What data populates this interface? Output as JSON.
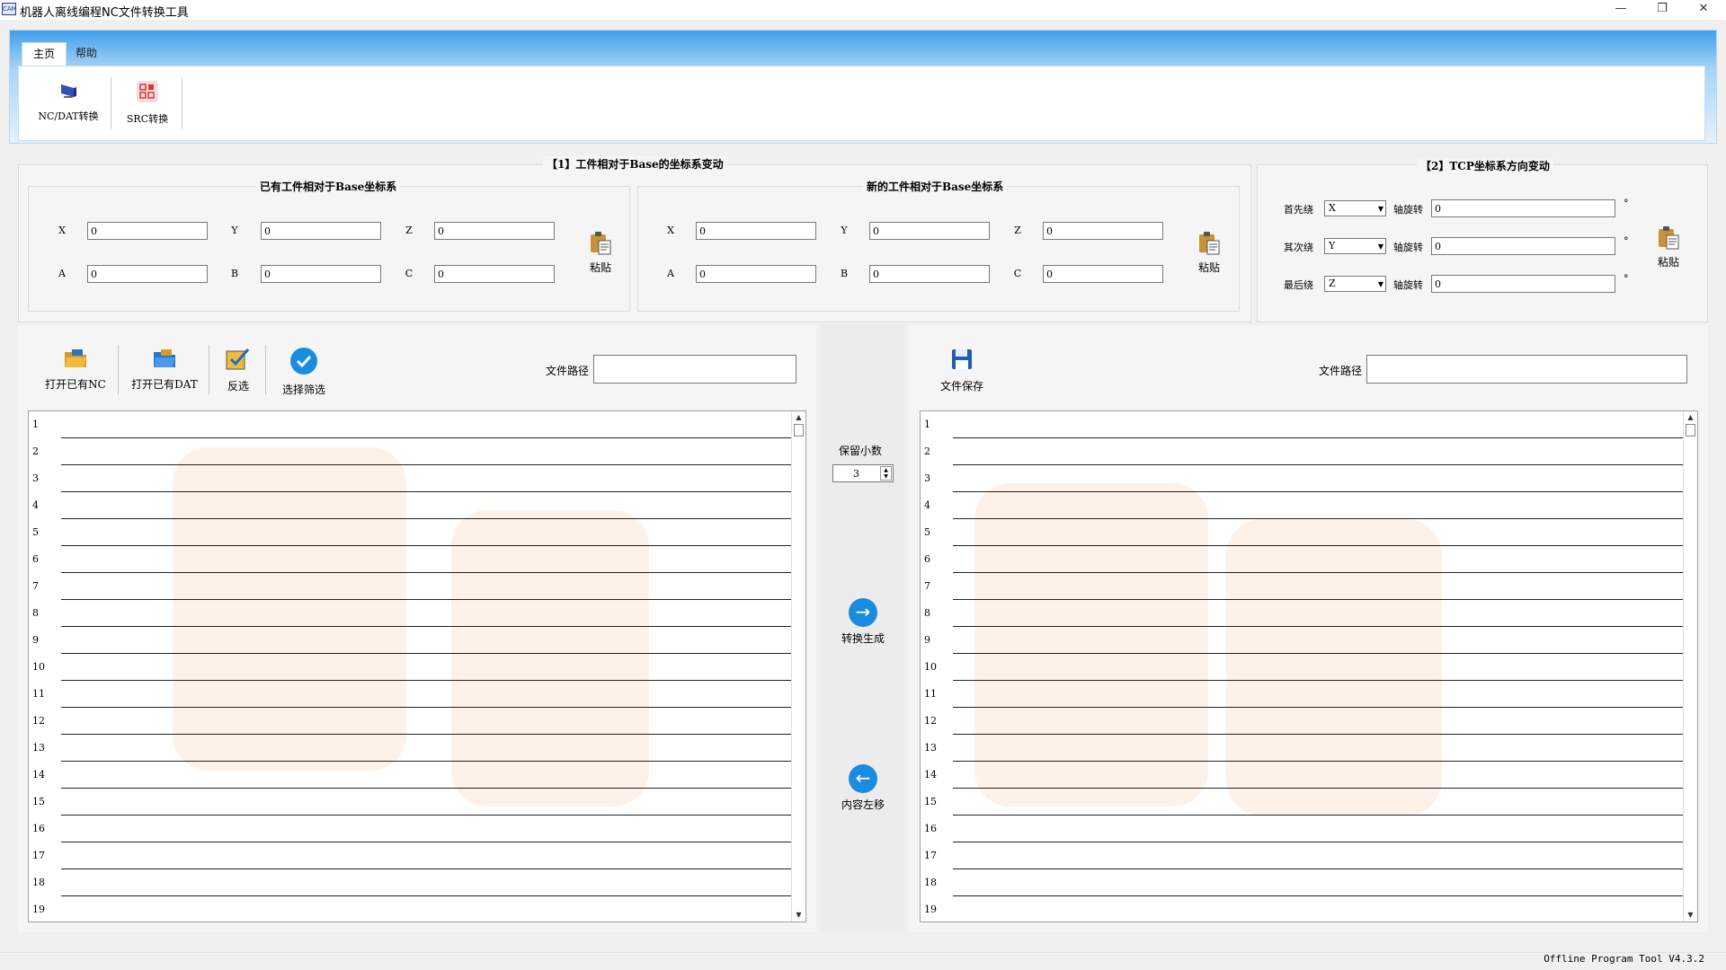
{
  "window": {
    "icon_text": "CAM",
    "title": "机器人离线编程NC文件转换工具",
    "minimize": "—",
    "restore": "❐",
    "close": "✕"
  },
  "ribbon": {
    "tabs": [
      "主页",
      "帮助"
    ],
    "buttons": [
      {
        "label": "NC/DAT转换",
        "icon": "monitor-icon"
      },
      {
        "label": "SRC转换",
        "icon": "src-grid-icon"
      }
    ]
  },
  "workpiece": {
    "title": "【1】工件相对于Base的坐标系变动",
    "existing": {
      "title": "已有工件相对于Base坐标系",
      "fields": [
        {
          "label": "X",
          "value": "0"
        },
        {
          "label": "Y",
          "value": "0"
        },
        {
          "label": "Z",
          "value": "0"
        },
        {
          "label": "A",
          "value": "0"
        },
        {
          "label": "B",
          "value": "0"
        },
        {
          "label": "C",
          "value": "0"
        }
      ],
      "paste_label": "粘贴"
    },
    "new": {
      "title": "新的工件相对于Base坐标系",
      "fields": [
        {
          "label": "X",
          "value": "0"
        },
        {
          "label": "Y",
          "value": "0"
        },
        {
          "label": "Z",
          "value": "0"
        },
        {
          "label": "A",
          "value": "0"
        },
        {
          "label": "B",
          "value": "0"
        },
        {
          "label": "C",
          "value": "0"
        }
      ],
      "paste_label": "粘贴"
    }
  },
  "tcp": {
    "title": "【2】TCP坐标系方向变动",
    "rows": [
      {
        "order_label": "首先绕",
        "axis": "X",
        "rotate_label": "轴旋转",
        "value": "0",
        "unit": "°"
      },
      {
        "order_label": "其次绕",
        "axis": "Y",
        "rotate_label": "轴旋转",
        "value": "0",
        "unit": "°"
      },
      {
        "order_label": "最后绕",
        "axis": "Z",
        "rotate_label": "轴旋转",
        "value": "0",
        "unit": "°"
      }
    ],
    "paste_label": "粘贴"
  },
  "left_panel": {
    "open_nc": "打开已有NC",
    "open_dat": "打开已有DAT",
    "invert": "反选",
    "select_filter": "选择筛选",
    "path_label": "文件路径",
    "path_value": "",
    "line_numbers": [
      "1",
      "2",
      "3",
      "4",
      "5",
      "6",
      "7",
      "8",
      "9",
      "10",
      "11",
      "12",
      "13",
      "14",
      "15",
      "16",
      "17",
      "18",
      "19"
    ]
  },
  "middle": {
    "decimals_label": "保留小数",
    "decimals_value": "3",
    "convert_label": "转换生成",
    "move_left_label": "内容左移"
  },
  "right_panel": {
    "save_label": "文件保存",
    "path_label": "文件路径",
    "path_value": "",
    "line_numbers": [
      "1",
      "2",
      "3",
      "4",
      "5",
      "6",
      "7",
      "8",
      "9",
      "10",
      "11",
      "12",
      "13",
      "14",
      "15",
      "16",
      "17",
      "18",
      "19"
    ]
  },
  "status": {
    "version": "Offline Program Tool V4.3.2"
  },
  "colors": {
    "accent_blue": "#1a8ce0",
    "ribbon_top": "#40a0ec",
    "robot_orange": "#f07820"
  }
}
